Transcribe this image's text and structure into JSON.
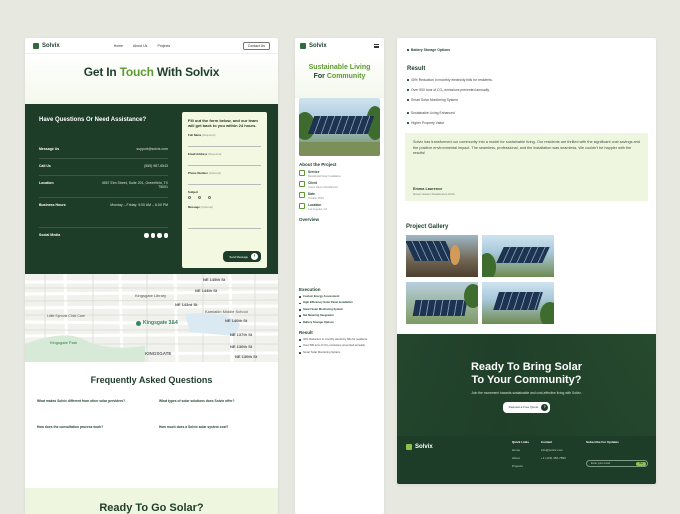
{
  "brand": "Solvix",
  "colors": {
    "dark_green": "#1d3d28",
    "accent_green": "#5c9b2f",
    "light_green": "#f3f9e1"
  },
  "contact_page": {
    "nav": {
      "links": [
        "Home",
        "About Us",
        "Projects"
      ],
      "cta": "Contact Us"
    },
    "hero": {
      "title_start": "Get In ",
      "title_accent": "Touch",
      "title_end": " With Solvix"
    },
    "assistance": {
      "heading": "Have Questions Or Need Assistance?",
      "rows": [
        {
          "label": "Message Us",
          "value": "support@solvix.com"
        },
        {
          "label": "Call Us",
          "value": "(555) 987-6543"
        },
        {
          "label": "Location",
          "value": "4567 Elm Street, Suite 201, Greenfield, TX 75001"
        },
        {
          "label": "Business Hours",
          "value": "Monday – Friday: 9:00 AM – 6:00 PM"
        },
        {
          "label": "Social Media",
          "value": ""
        }
      ]
    },
    "form": {
      "heading": "Fill out the form below, and our team will get back to you within 24 hours.",
      "fields": [
        {
          "label": "Full Name",
          "required": "(Required)"
        },
        {
          "label": "Email Address",
          "required": "(Required)"
        },
        {
          "label": "Phone Number",
          "required": "(Optional)"
        },
        {
          "label": "Subject",
          "required": ""
        },
        {
          "label": "Message",
          "required": "(Optional)"
        }
      ],
      "send": "Send Message"
    },
    "map": {
      "streets": [
        "NE 145th St",
        "NE 144th St",
        "NE 143rd St",
        "NE 140th St",
        "NE 137th St",
        "NE 136th St",
        "KINGSGATE",
        "NE 130th St"
      ],
      "pois": [
        "Kingsgate Library",
        "Kingsgate 3&4",
        "Kamiakin Middle School",
        "Kingsgate Park",
        "Little Sprouts Child Care"
      ]
    },
    "faq": {
      "heading": "Frequently Asked Questions",
      "items": [
        {
          "q": "What makes Solvix different from other solar providers?"
        },
        {
          "q": "What types of solar solutions does Solvix offer?"
        },
        {
          "q": "How does the consultation process work?"
        },
        {
          "q": "How much does a Solvix solar system cost?"
        }
      ]
    },
    "bottom_cta": "Ready To Go Solar?"
  },
  "project_mobile": {
    "title_accent": "Sustainable Living",
    "title_line2_start": "For ",
    "title_line2_accent": "Community",
    "about_heading": "About the Project",
    "info": [
      {
        "label": "Service",
        "value": "Residential Solar Installation"
      },
      {
        "label": "Client",
        "value": "Green Haven Residences"
      },
      {
        "label": "Date",
        "value": "October 2024"
      },
      {
        "label": "Location",
        "value": "Los Angeles, CA"
      }
    ],
    "overview_heading": "Overview",
    "execution_heading": "Execution",
    "execution_items": [
      {
        "title": "Custom Energy Assessment"
      },
      {
        "title": "High-Efficiency Solar Panel Installation"
      },
      {
        "title": "Smart Solar Monitoring System"
      },
      {
        "title": "Net Metering Integration"
      },
      {
        "title": "Battery Storage Options"
      }
    ],
    "result_heading": "Result",
    "result_items": [
      "40% Reduction in monthly electricity bills for residents.",
      "Over 500 tons of CO₂ emissions prevented annually.",
      "Smart Solar Monitoring System"
    ]
  },
  "project_desktop": {
    "top_item": "Battery Storage Options",
    "result_heading": "Result",
    "result_items": [
      "40% Reduction in monthly electricity bills for residents.",
      "Over 500 tons of CO₂ emissions prevented annually.",
      "Smart Solar Monitoring System",
      "Sustainable Living Enhanced",
      "Higher Property Value"
    ],
    "testimonial": {
      "text": "Solvix has transformed our community into a model for sustainable living. Our residents are thrilled with the significant cost savings and the positive environmental impact. The seamless, professional, and the installation was seamless. We couldn't be happier with the results!",
      "name": "Emma Laurence",
      "org": "Green Haven Residences HOA"
    },
    "gallery_heading": "Project Gallery",
    "cta": {
      "line1": "Ready To Bring Solar",
      "line2": "To Your Community?",
      "sub": "Join the movement towards sustainable and cost-effective living with Solvix.",
      "button": "Request a Free Quote"
    },
    "footer": {
      "quick_links": {
        "heading": "Quick Links",
        "items": [
          "Home",
          "About",
          "Projects"
        ]
      },
      "contact": {
        "heading": "Contact",
        "items": [
          "info@solvix.com",
          "+1 (123) 456-7890"
        ]
      },
      "updates": {
        "heading": "Subscribe For Updates",
        "placeholder": "Enter your email",
        "button": "Go"
      }
    }
  }
}
